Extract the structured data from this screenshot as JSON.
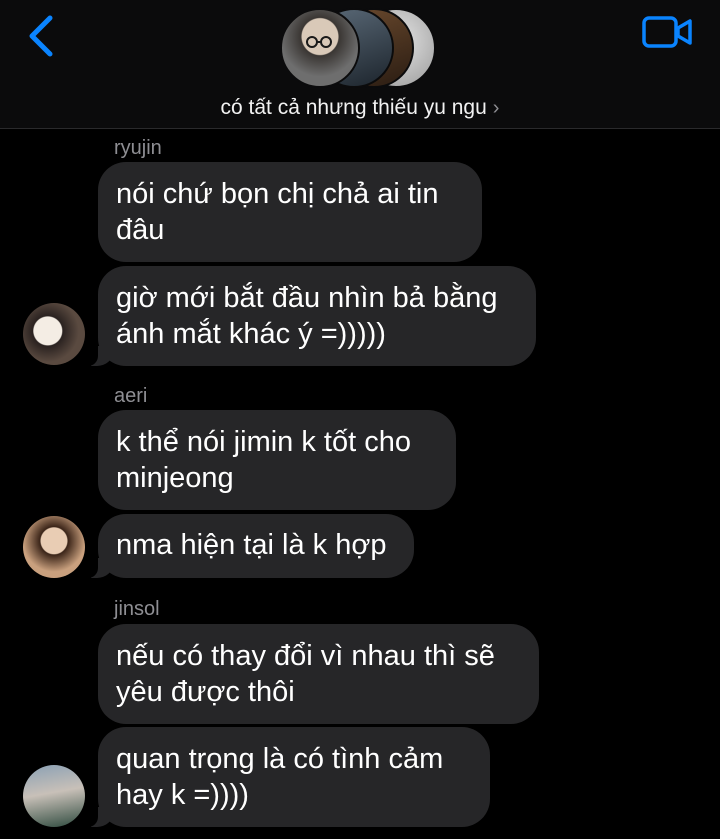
{
  "header": {
    "group_name": "có tất cả nhưng thiếu yu ngu",
    "chevron": "›",
    "back_icon": "chevron-left-icon",
    "video_icon": "video-camera-icon",
    "accent_color": "#0a84ff"
  },
  "messages": [
    {
      "sender": "ryujin",
      "bubbles": [
        "nói chứ bọn chị chả ai tin\nđâu",
        "giờ mới bắt đầu nhìn bả bằng\nánh mắt khác ý =)))))"
      ]
    },
    {
      "sender": "aeri",
      "bubbles": [
        "k thể nói jimin k tốt cho\nminjeong",
        "nma hiện tại là k hợp"
      ]
    },
    {
      "sender": "jinsol",
      "bubbles": [
        "nếu có thay đổi vì nhau thì sẽ\nyêu được thôi",
        "quan trọng là có tình cảm\nhay k =))))"
      ]
    }
  ],
  "colors": {
    "bubble": "#262628",
    "background": "#000000",
    "sender_label": "#8e8e93"
  }
}
